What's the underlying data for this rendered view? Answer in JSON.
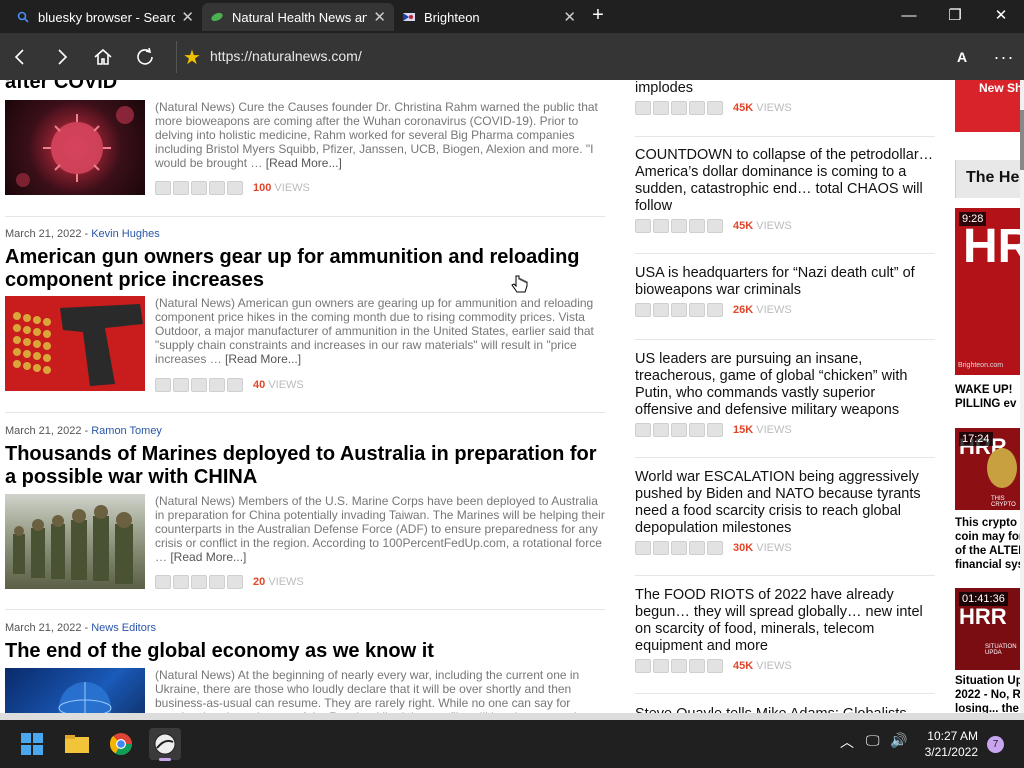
{
  "tabs": [
    {
      "label": "bluesky browser - Searc",
      "icon": "search-icon"
    },
    {
      "label": "Natural Health News an",
      "icon": "leaf-icon"
    },
    {
      "label": "Brighteon",
      "icon": "brighteon-flag-icon"
    }
  ],
  "address": {
    "url": "https://naturalnews.com/"
  },
  "articles": [
    {
      "date": "",
      "author": "",
      "title": "after COVID",
      "desc": "(Natural News) Cure the Causes founder Dr. Christina Rahm warned the public that more bioweapons are coming after the Wuhan coronavirus (COVID-19). Prior to delving into holistic medicine, Rahm worked for several Big Pharma companies including Bristol Myers Squibb, Pfizer, Janssen, UCB, Biogen, Alexion and more. \"I would be brought …",
      "read_more": "[Read More...]",
      "views": "100",
      "views_label": "VIEWS"
    },
    {
      "date": "March 21, 2022 - ",
      "author": "Kevin Hughes",
      "title": "American gun owners gear up for ammunition and reloading component price increases",
      "desc": "(Natural News) American gun owners are gearing up for ammunition and reloading component price hikes in the coming month due to rising commodity prices. Vista Outdoor, a major manufacturer of ammunition in the United States, earlier said that \"supply chain constraints and increases in our raw materials\" will result in \"price increases …",
      "read_more": "[Read More...]",
      "views": "40",
      "views_label": "VIEWS"
    },
    {
      "date": "March 21, 2022 - ",
      "author": "Ramon Tomey",
      "title": "Thousands of Marines deployed to Australia in preparation for a possible war with CHINA",
      "desc": "(Natural News) Members of the U.S. Marine Corps have been deployed to Australia in preparation for China potentially invading Taiwan. The Marines will be helping their counterparts in the Australian Defense Force (ADF) to ensure preparedness for any crisis or conflict in the region. According to 100PercentFedUp.com, a rotational force …",
      "read_more": "[Read More...]",
      "views": "20",
      "views_label": "VIEWS"
    },
    {
      "date": "March 21, 2022 - ",
      "author": "News Editors",
      "title": "The end of the global economy as we know it",
      "desc": "(Natural News) At the beginning of nearly every war, including the current one in Ukraine, there are those who loudly declare that it will be over shortly and then business-as-usual can resume. They are rarely right. While no one can say for certain what the trajectory of the Russian-Ukrainian conflict will be, the economic …",
      "read_more": "",
      "views": "",
      "views_label": ""
    }
  ],
  "mid_items": [
    {
      "title": "implodes",
      "views": "45K",
      "views_label": "VIEWS"
    },
    {
      "title": "COUNTDOWN to collapse of the petrodollar… America’s dollar dominance is coming to a sudden, catastrophic end… total CHAOS will follow",
      "views": "45K",
      "views_label": "VIEWS"
    },
    {
      "title": "USA is headquarters for “Nazi death cult” of bioweapons war criminals",
      "views": "26K",
      "views_label": "VIEWS"
    },
    {
      "title": "US leaders are pursuing an insane, treacherous, game of global “chicken” with Putin, who commands vastly superior offensive and defensive military weapons",
      "views": "15K",
      "views_label": "VIEWS"
    },
    {
      "title": "World war ESCALATION being aggressively pushed by Biden and NATO because tyrants need a food scarcity crisis to reach global depopulation milestones",
      "views": "30K",
      "views_label": "VIEWS"
    },
    {
      "title": "The FOOD RIOTS of 2022 have already begun… they will spread globally… new intel on scarcity of food, minerals, telecom equipment and more",
      "views": "45K",
      "views_label": "VIEWS"
    },
    {
      "title": "Steve Quayle tells Mike Adams: Globalists",
      "views": "",
      "views_label": ""
    }
  ],
  "right": {
    "banner_text": "New Sh",
    "heading": "The Hea",
    "videos": [
      {
        "duration": "9:28",
        "title_lines": [
          "WAKE UP!",
          "PILLING ev"
        ],
        "thumb_text": "HRR",
        "thumb_sub": "Brighteon.com"
      },
      {
        "duration": "17:24",
        "title_lines": [
          "This crypto",
          "coin may for",
          "of the ALTER",
          "financial sys"
        ],
        "thumb_text": "HRR",
        "thumb_sub": "THIS CRYPTO"
      },
      {
        "duration": "01:41:36",
        "title_lines": [
          "Situation Up",
          "2022 - No, R",
          "losing... the",
          "…"
        ],
        "thumb_text": "HRR",
        "thumb_sub": "SITUATION UPDA"
      }
    ]
  },
  "taskbar": {
    "time": "10:27 AM",
    "date": "3/21/2022",
    "notifications": "7"
  },
  "colors": {
    "accent_views": "#e2452a",
    "author_link": "#2a56a8",
    "tabbar": "#202020",
    "toolbar": "#353535"
  }
}
